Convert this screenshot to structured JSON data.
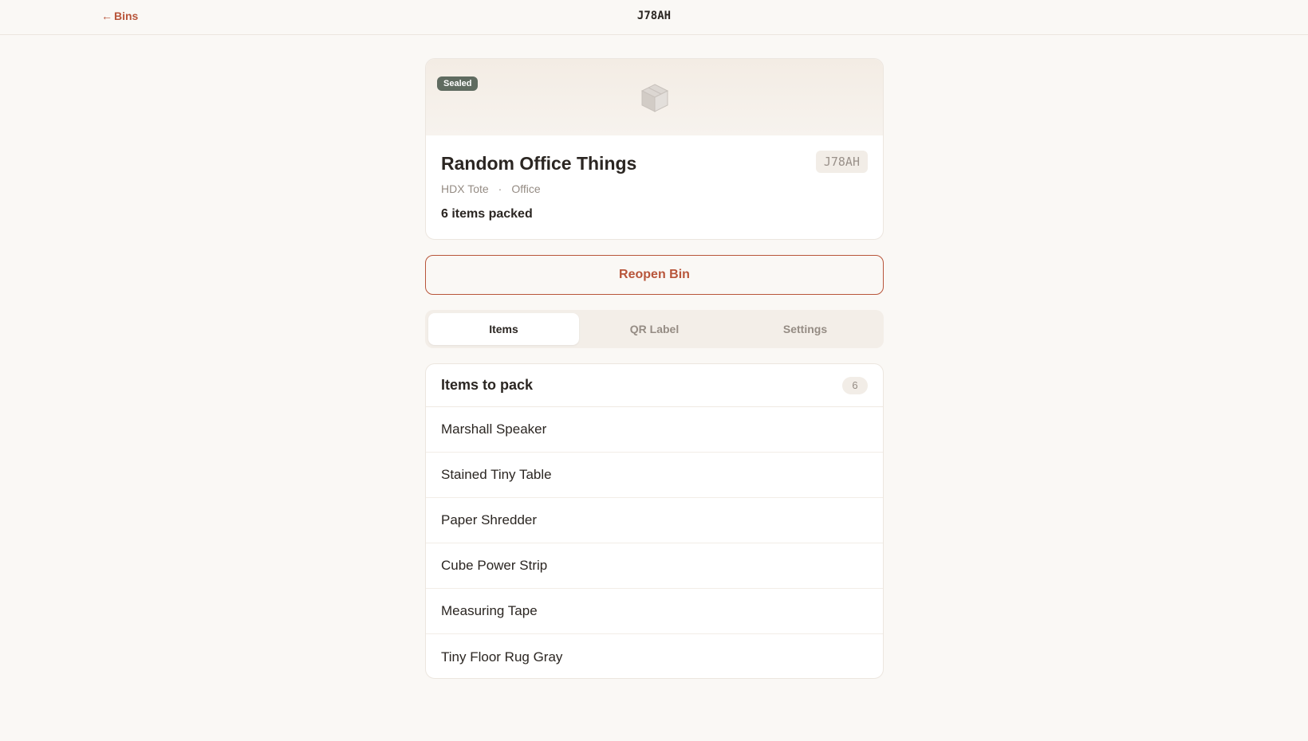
{
  "topbar": {
    "back_arrow": "←",
    "back_label": "Bins",
    "title": "J78AH"
  },
  "bin": {
    "badge": "Sealed",
    "name": "Random Office Things",
    "code": "J78AH",
    "container": "HDX Tote",
    "separator": "·",
    "location": "Office",
    "count_text": "6 items packed",
    "icon": "box-icon"
  },
  "actions": {
    "reopen_label": "Reopen Bin"
  },
  "tabs": [
    {
      "label": "Items",
      "active": true
    },
    {
      "label": "QR Label",
      "active": false
    },
    {
      "label": "Settings",
      "active": false
    }
  ],
  "items_section": {
    "title": "Items to pack",
    "count": "6",
    "items": [
      "Marshall Speaker",
      "Stained Tiny Table",
      "Paper Shredder",
      "Cube Power Strip",
      "Measuring Tape",
      "Tiny Floor Rug Gray"
    ]
  },
  "colors": {
    "accent": "#b8553a",
    "sealed_badge": "#5f6b60",
    "background": "#faf8f5"
  }
}
